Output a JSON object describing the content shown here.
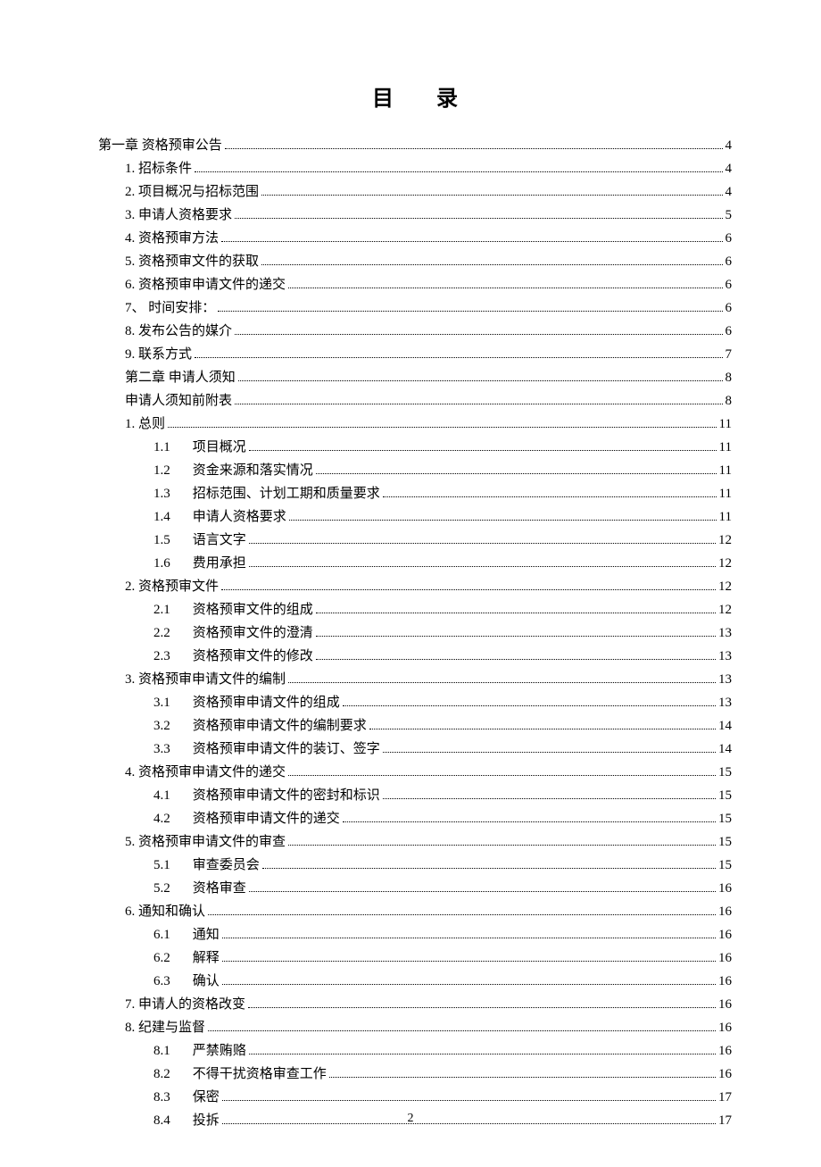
{
  "title": "目录",
  "page_number": "2",
  "toc": [
    {
      "indent": 0,
      "num": "第一章",
      "text": "资格预审公告",
      "page": "4"
    },
    {
      "indent": 1,
      "num": "1.",
      "text": "招标条件",
      "page": "4"
    },
    {
      "indent": 1,
      "num": "2.",
      "text": "项目概况与招标范围",
      "page": "4"
    },
    {
      "indent": 1,
      "num": "3.",
      "text": "申请人资格要求",
      "page": "5"
    },
    {
      "indent": 1,
      "num": "4.",
      "text": "资格预审方法",
      "page": "6"
    },
    {
      "indent": 1,
      "num": "5.",
      "text": "资格预审文件的获取",
      "page": "6"
    },
    {
      "indent": 1,
      "num": "6.",
      "text": "资格预审申请文件的递交",
      "page": "6"
    },
    {
      "indent": 1,
      "num": "7、",
      "text": "时间安排：",
      "page": "6"
    },
    {
      "indent": 1,
      "num": "8.",
      "text": "发布公告的媒介",
      "page": "6"
    },
    {
      "indent": 1,
      "num": "9.",
      "text": "联系方式",
      "page": "7"
    },
    {
      "indent": 2,
      "num": "第二章",
      "text": "申请人须知",
      "page": "8"
    },
    {
      "indent": 2,
      "num": "",
      "text": "申请人须知前附表",
      "page": "8"
    },
    {
      "indent": 2,
      "num": "",
      "text": "1. 总则",
      "page": "11"
    },
    {
      "indent": 3,
      "num": "1.1",
      "text": "项目概况",
      "page": "11"
    },
    {
      "indent": 3,
      "num": "1.2",
      "text": "资金来源和落实情况",
      "page": "11"
    },
    {
      "indent": 3,
      "num": "1.3",
      "text": "招标范围、计划工期和质量要求",
      "page": "11"
    },
    {
      "indent": 3,
      "num": "1.4",
      "text": "申请人资格要求",
      "page": "11"
    },
    {
      "indent": 3,
      "num": "1.5",
      "text": "语言文字",
      "page": "12"
    },
    {
      "indent": 3,
      "num": "1.6",
      "text": "费用承担",
      "page": "12"
    },
    {
      "indent": 1,
      "num": "2.",
      "text": "资格预审文件",
      "page": "12"
    },
    {
      "indent": 3,
      "num": "2.1",
      "text": "资格预审文件的组成",
      "page": "12"
    },
    {
      "indent": 3,
      "num": "2.2",
      "text": "资格预审文件的澄清",
      "page": "13"
    },
    {
      "indent": 3,
      "num": "2.3",
      "text": "资格预审文件的修改",
      "page": "13"
    },
    {
      "indent": 2,
      "num": "",
      "text": "3. 资格预审申请文件的编制",
      "page": "13"
    },
    {
      "indent": 3,
      "num": "3.1",
      "text": "资格预审申请文件的组成",
      "page": "13"
    },
    {
      "indent": 3,
      "num": "3.2",
      "text": "资格预审申请文件的编制要求",
      "page": "14"
    },
    {
      "indent": 3,
      "num": "3.3",
      "text": "资格预审申请文件的装订、签字",
      "page": "14"
    },
    {
      "indent": 1,
      "num": "4.",
      "text": "资格预审申请文件的递交",
      "page": "15"
    },
    {
      "indent": 3,
      "num": "4.1",
      "text": "资格预审申请文件的密封和标识",
      "page": "15"
    },
    {
      "indent": 3,
      "num": "4.2",
      "text": "资格预审申请文件的递交",
      "page": "15"
    },
    {
      "indent": 2,
      "num": "",
      "text": "5. 资格预审申请文件的审查",
      "page": "15"
    },
    {
      "indent": 3,
      "num": "5.1",
      "text": "审查委员会",
      "page": "15"
    },
    {
      "indent": 3,
      "num": "5.2",
      "text": "资格审查",
      "page": "16"
    },
    {
      "indent": 1,
      "num": "6.",
      "text": "通知和确认",
      "page": "16"
    },
    {
      "indent": 3,
      "num": "6.1",
      "text": "通知",
      "page": "16"
    },
    {
      "indent": 3,
      "num": "6.2",
      "text": "解释",
      "page": "16"
    },
    {
      "indent": 3,
      "num": "6.3",
      "text": "确认",
      "page": "16"
    },
    {
      "indent": 1,
      "num": "7.",
      "text": "申请人的资格改变",
      "page": "16"
    },
    {
      "indent": 1,
      "num": "8.",
      "text": "纪建与监督",
      "page": "16"
    },
    {
      "indent": 3,
      "num": "8.1",
      "text": "严禁贿赂",
      "page": "16"
    },
    {
      "indent": 3,
      "num": "8.2",
      "text": "不得干扰资格审查工作",
      "page": "16"
    },
    {
      "indent": 3,
      "num": "8.3",
      "text": "保密",
      "page": "17"
    },
    {
      "indent": 3,
      "num": "8.4",
      "text": "投拆",
      "page": "17"
    }
  ]
}
